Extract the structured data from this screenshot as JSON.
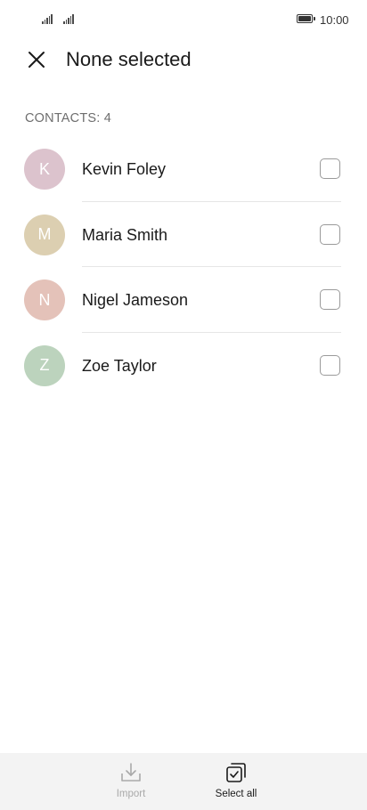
{
  "status_bar": {
    "time": "10:00"
  },
  "header": {
    "title": "None selected",
    "close_icon": "close-icon"
  },
  "contacts_section": {
    "header": "CONTACTS: 4",
    "items": [
      {
        "initial": "K",
        "name": "Kevin Foley",
        "avatar_color": "#dcc3cd",
        "checked": false
      },
      {
        "initial": "M",
        "name": "Maria Smith",
        "avatar_color": "#dccfb1",
        "checked": false
      },
      {
        "initial": "N",
        "name": "Nigel Jameson",
        "avatar_color": "#e4c2b9",
        "checked": false
      },
      {
        "initial": "Z",
        "name": "Zoe Taylor",
        "avatar_color": "#bcd3bd",
        "checked": false
      }
    ]
  },
  "bottom_bar": {
    "import": {
      "label": "Import",
      "icon": "import-icon",
      "enabled": false
    },
    "select_all": {
      "label": "Select all",
      "icon": "select-all-icon",
      "enabled": true
    }
  }
}
